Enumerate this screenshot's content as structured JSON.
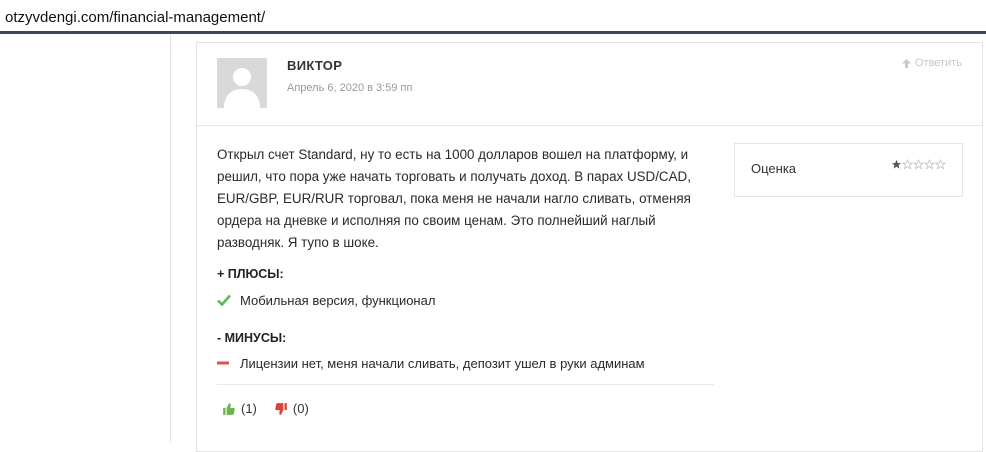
{
  "browser": {
    "url": "otzyvdengi.com/financial-management/"
  },
  "review": {
    "author": "ВИКТОР",
    "date": "Апрель 6, 2020 в 3:59 пп",
    "reply_label": "Ответить",
    "text": "Открыл счет Standard, ну то есть на 1000 долларов вошел на платформу, и решил, что пора уже начать торговать и получать доход. В парах USD/CAD, EUR/GBP, EUR/RUR торговал, пока меня не начали нагло сливать, отменяя ордера на дневке и исполняя по своим ценам. Это полнейший наглый разводняк. Я тупо в шоке.",
    "rating": {
      "label": "Оценка",
      "value": 1,
      "max": 5
    },
    "pros": {
      "title": "+ ПЛЮСЫ:",
      "items": [
        "Мобильная версия, функционал"
      ]
    },
    "cons": {
      "title": "- МИНУСЫ:",
      "items": [
        "Лицензии нет, меня начали сливать, депозит ушел в руки админам"
      ]
    },
    "votes": {
      "up": "(1)",
      "down": "(0)"
    }
  },
  "colors": {
    "url_bar_border": "#3c4758",
    "check_green": "#5cb85c",
    "minus_red": "#d9534f",
    "thumb_up": "#6bb34a",
    "thumb_down": "#d9433b",
    "star": "#bbbbbb"
  },
  "icons": {
    "reply": "reply-arrow-icon",
    "check": "check-icon",
    "minus": "minus-icon",
    "thumb_up": "thumb-up-icon",
    "thumb_down": "thumb-down-icon",
    "star": "star-icon"
  }
}
